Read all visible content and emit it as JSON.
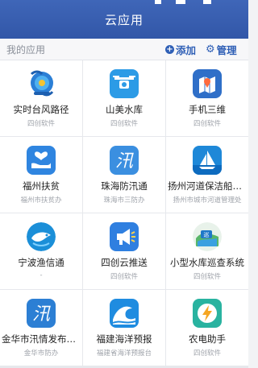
{
  "header": {
    "title": "云应用"
  },
  "subbar": {
    "section_label": "我的应用",
    "add_label": "添加",
    "manage_label": "管理"
  },
  "apps": [
    {
      "name": "实时台风路径",
      "org": "四创软件",
      "icon": "typhoon-icon"
    },
    {
      "name": "山美水库",
      "org": "四创软件",
      "icon": "drone-icon"
    },
    {
      "name": "手机三维",
      "org": "四创软件",
      "icon": "map-pin-icon"
    },
    {
      "name": "福州扶贫",
      "org": "福州市扶贫办",
      "icon": "heart-hand-icon"
    },
    {
      "name": "珠海防汛通",
      "org": "珠海市三防办",
      "icon": "flood-icon"
    },
    {
      "name": "扬州河道保洁船只管...",
      "org": "扬州市城市河道管理处",
      "icon": "sailboat-icon"
    },
    {
      "name": "宁波渔信通",
      "org": "-",
      "icon": "fish-icon"
    },
    {
      "name": "四创云推送",
      "org": "四创软件",
      "icon": "megaphone-icon"
    },
    {
      "name": "小型水库巡查系统",
      "org": "四创软件",
      "icon": "reservoir-icon"
    },
    {
      "name": "金华市汛情发布系统",
      "org": "金华市防办",
      "icon": "flood-icon"
    },
    {
      "name": "福建海洋预报",
      "org": "福建省海洋预报台",
      "icon": "wave-icon"
    },
    {
      "name": "农电助手",
      "org": "四创软件",
      "icon": "lightning-icon"
    }
  ]
}
